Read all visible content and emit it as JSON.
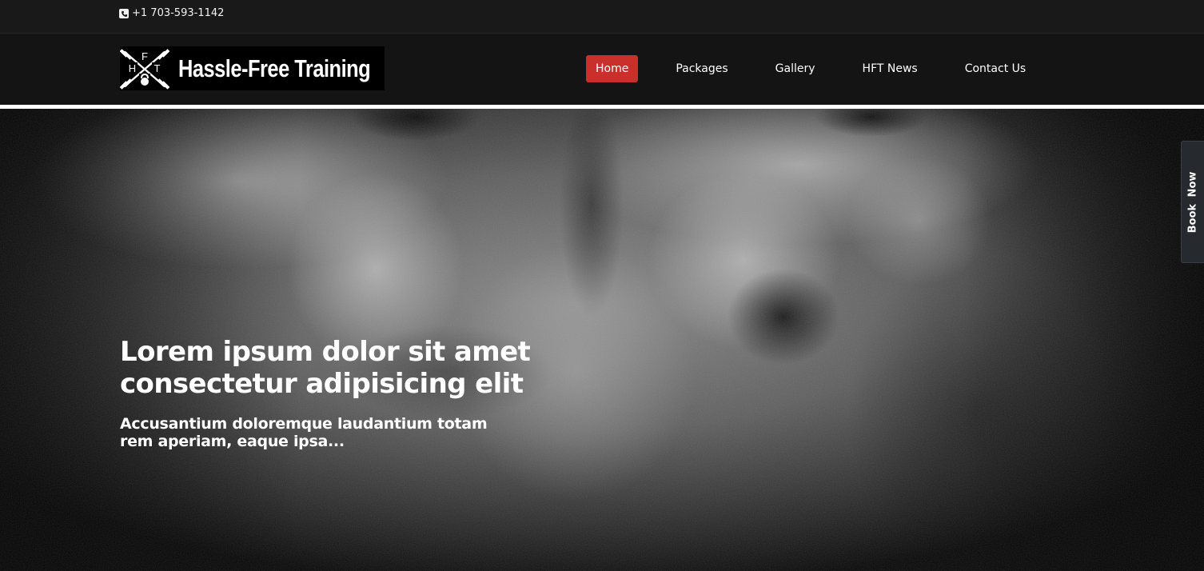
{
  "topbar": {
    "phone_icon": "phone-icon",
    "phone": "+1 703-593-1142"
  },
  "header": {
    "logo": {
      "letters": [
        "H",
        "F",
        "T"
      ],
      "icon": "kettlebell-icon",
      "text": "Hassle-Free Training"
    },
    "nav": [
      {
        "label": "Home",
        "active": true
      },
      {
        "label": "Packages",
        "active": false
      },
      {
        "label": "Gallery",
        "active": false
      },
      {
        "label": "HFT News",
        "active": false
      },
      {
        "label": "Contact Us",
        "active": false
      }
    ]
  },
  "hero": {
    "title": "Lorem ipsum dolor sit amet consectetur adipisicing elit",
    "subtitle": "Accusantium doloremque laudantium totam rem aperiam, eaque ipsa..."
  },
  "book_now": {
    "label": "Book Now"
  },
  "colors": {
    "accent": "#c9302c",
    "topbar_bg": "#191919",
    "header_bg": "#141414"
  }
}
